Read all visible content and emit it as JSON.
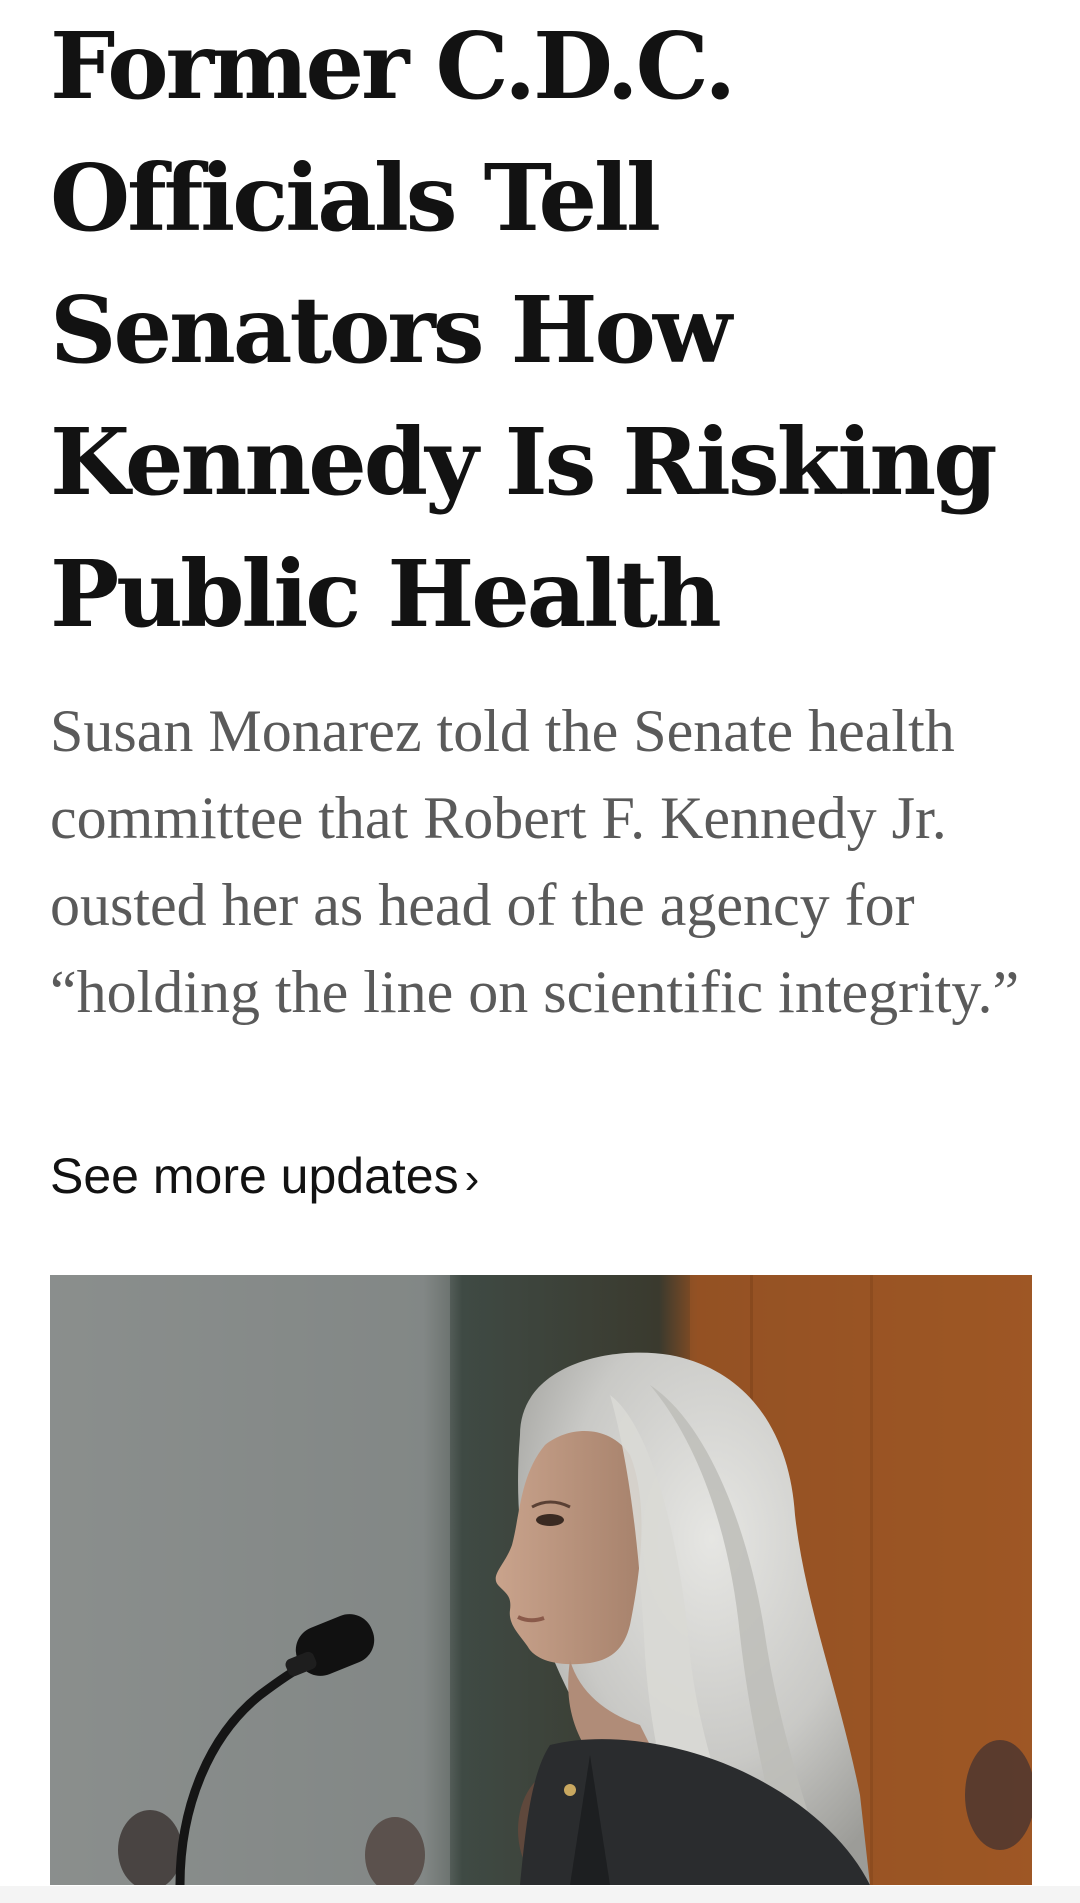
{
  "article": {
    "headline_lines": [
      "Former C.D.C.",
      "Officials Tell",
      "Senators How",
      "Kennedy Is Risking",
      "Public Health"
    ],
    "summary": "Susan Monarez told the Senate health committee that Robert F. Kennedy Jr. ousted her as head of the agency for “holding the line on scientific integrity.”",
    "more_link_label": "See more updates",
    "more_link_chevron": "›"
  },
  "colors": {
    "headline": "#121212",
    "summary": "#5a5a5a",
    "link": "#121212",
    "background": "#ffffff"
  }
}
